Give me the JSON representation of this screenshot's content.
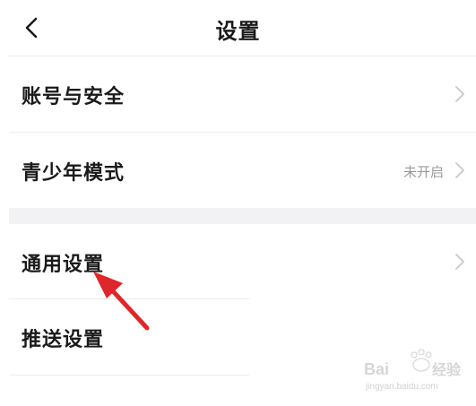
{
  "header": {
    "title": "设置",
    "back_icon": "chevron-left-icon"
  },
  "settings": {
    "account_security": {
      "label": "账号与安全",
      "icon": "chevron-right-icon"
    },
    "teen_mode": {
      "label": "青少年模式",
      "status": "未开启",
      "icon": "chevron-right-icon"
    },
    "general": {
      "label": "通用设置",
      "icon": "chevron-right-icon"
    },
    "push": {
      "label": "推送设置"
    }
  },
  "annotation": {
    "icon": "red-pointer-arrow",
    "color": "#e0262b"
  },
  "watermark": {
    "brand": "Baidu经验",
    "url": "jingyan.baidu.com"
  },
  "colors": {
    "text": "#1a1a1a",
    "muted": "#9b9b9b",
    "divider": "#ececec",
    "section_gap": "#f2f2f4",
    "chevron": "#c8c8c8"
  }
}
